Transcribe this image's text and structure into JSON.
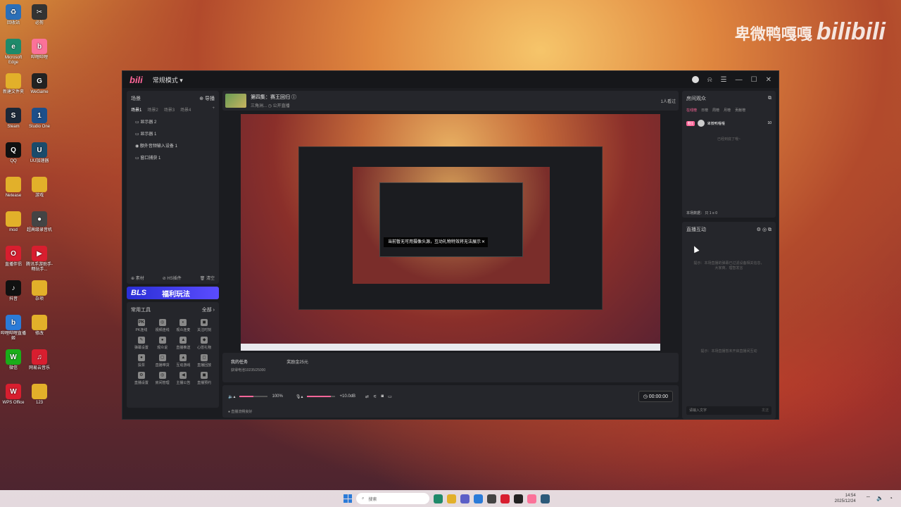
{
  "watermark": {
    "text": "卑微鸭嘎嘎",
    "brand": "bilibili"
  },
  "desktop_icons": [
    {
      "label": "回收站",
      "color": "#2b6fb8",
      "glyph": "♻"
    },
    {
      "label": "必剪",
      "color": "#333",
      "glyph": "✂"
    },
    {
      "label": "Microsoft Edge",
      "color": "#1f8a6a",
      "glyph": "e"
    },
    {
      "label": "哔哩哔哩",
      "color": "#fb7299",
      "glyph": "b"
    },
    {
      "label": "新建文件夹",
      "color": "#e2b02a",
      "glyph": ""
    },
    {
      "label": "WeGame",
      "color": "#222",
      "glyph": "G"
    },
    {
      "label": "Steam",
      "color": "#1b2838",
      "glyph": "S"
    },
    {
      "label": "Studio One",
      "color": "#1d4f8a",
      "glyph": "1"
    },
    {
      "label": "QQ",
      "color": "#111",
      "glyph": "Q"
    },
    {
      "label": "UU加速器",
      "color": "#1a4b6b",
      "glyph": "U"
    },
    {
      "label": "Netease",
      "color": "#e2b02a",
      "glyph": ""
    },
    {
      "label": "游戏",
      "color": "#e2b02a",
      "glyph": ""
    },
    {
      "label": "mod",
      "color": "#e2b02a",
      "glyph": ""
    },
    {
      "label": "超高级录音机",
      "color": "#444",
      "glyph": "●"
    },
    {
      "label": "直播伴侣",
      "color": "#d81e2f",
      "glyph": "O"
    },
    {
      "label": "腾讯手游助手-畅玩手...",
      "color": "#d81e2f",
      "glyph": "▶"
    },
    {
      "label": "抖音",
      "color": "#111",
      "glyph": "♪"
    },
    {
      "label": "杂项",
      "color": "#e2b02a",
      "glyph": ""
    },
    {
      "label": "哔哩哔哩直播姬",
      "color": "#2b7bd8",
      "glyph": "b"
    },
    {
      "label": "修改",
      "color": "#e2b02a",
      "glyph": ""
    },
    {
      "label": "微信",
      "color": "#1aad19",
      "glyph": "W"
    },
    {
      "label": "网易云音乐",
      "color": "#d81e2f",
      "glyph": "♫"
    },
    {
      "label": "WPS Office",
      "color": "#d81e2f",
      "glyph": "W"
    },
    {
      "label": "123",
      "color": "#e2b02a",
      "glyph": ""
    }
  ],
  "app": {
    "logo": "bili",
    "mode": "常规模式 ▾",
    "scene": {
      "title": "场景",
      "import": "⊕ 导播",
      "tabs": [
        "场景1",
        "场景2",
        "场景3",
        "场景4",
        "+"
      ],
      "sources": [
        "显示器 2",
        "显示器 1",
        "额外音频输入设备 1",
        "窗口捕获 1"
      ],
      "footer": [
        "⊕ 素材",
        "⊘ HS插件",
        "🗑 清空"
      ]
    },
    "bls": {
      "brand": "BLS",
      "text": "福利玩法"
    },
    "tools": {
      "title": "常用工具",
      "more": "全部 ›",
      "items": [
        {
          "icon": "PK",
          "label": "PK连线"
        },
        {
          "icon": "◎",
          "label": "视频连线"
        },
        {
          "icon": "◐",
          "label": "观众连麦"
        },
        {
          "icon": "◼",
          "label": "关注时刻"
        },
        {
          "icon": "✎",
          "label": "弹幕设置"
        },
        {
          "icon": "●",
          "label": "观众说"
        },
        {
          "icon": "▲",
          "label": "直播推送"
        },
        {
          "icon": "◆",
          "label": "心愿礼物"
        },
        {
          "icon": "●",
          "label": "投票"
        },
        {
          "icon": "◻",
          "label": "直播带货"
        },
        {
          "icon": "▲",
          "label": "互动游戏"
        },
        {
          "icon": "◻",
          "label": "直播回放"
        },
        {
          "icon": "⚙",
          "label": "直播设置"
        },
        {
          "icon": "◎",
          "label": "房间管理"
        },
        {
          "icon": "◀",
          "label": "主播公告"
        },
        {
          "icon": "◼",
          "label": "直播预约"
        }
      ]
    },
    "room": {
      "title": "第四集：赛王回归 ⓘ",
      "subtitle": "三角洲... ◷ 公开直播",
      "viewers": "1人看过"
    },
    "toast": "当前暂无可用摄像头源，互动礼物特效将无法展示",
    "tasks": {
      "title": "我的任务",
      "sub": "获得电池10235/25000",
      "reward": "奖励金25元"
    },
    "controls": {
      "speaker_pct": "100%",
      "mic_db": "+10.0dB",
      "timer": "◷ 00:00:00",
      "status": "● 直播流畅良好",
      "speaker_level": 0.5,
      "mic_level": 0.85
    },
    "audience": {
      "title": "房间观众",
      "tabs": [
        "在线榜",
        "日榜",
        "周榜",
        "月榜",
        "贡献榜"
      ],
      "user": {
        "level": "粉1",
        "name": "卑微鸭嘎嘎",
        "score": "10"
      },
      "empty": "已经到底了哦~",
      "stats": "本场数据：  只 1   ≡ 0"
    },
    "interact": {
      "title": "直播互动",
      "hint": "提示：本场直播的弹幕已过滤设备相关信息，大家爽、理智发言",
      "hint2": "提示：本场直播暂未开启直播间互动",
      "input_placeholder": "请输入文字",
      "send": "发送"
    }
  },
  "taskbar": {
    "search": "搜索",
    "time": "14:54",
    "date": "2025/12/24"
  }
}
